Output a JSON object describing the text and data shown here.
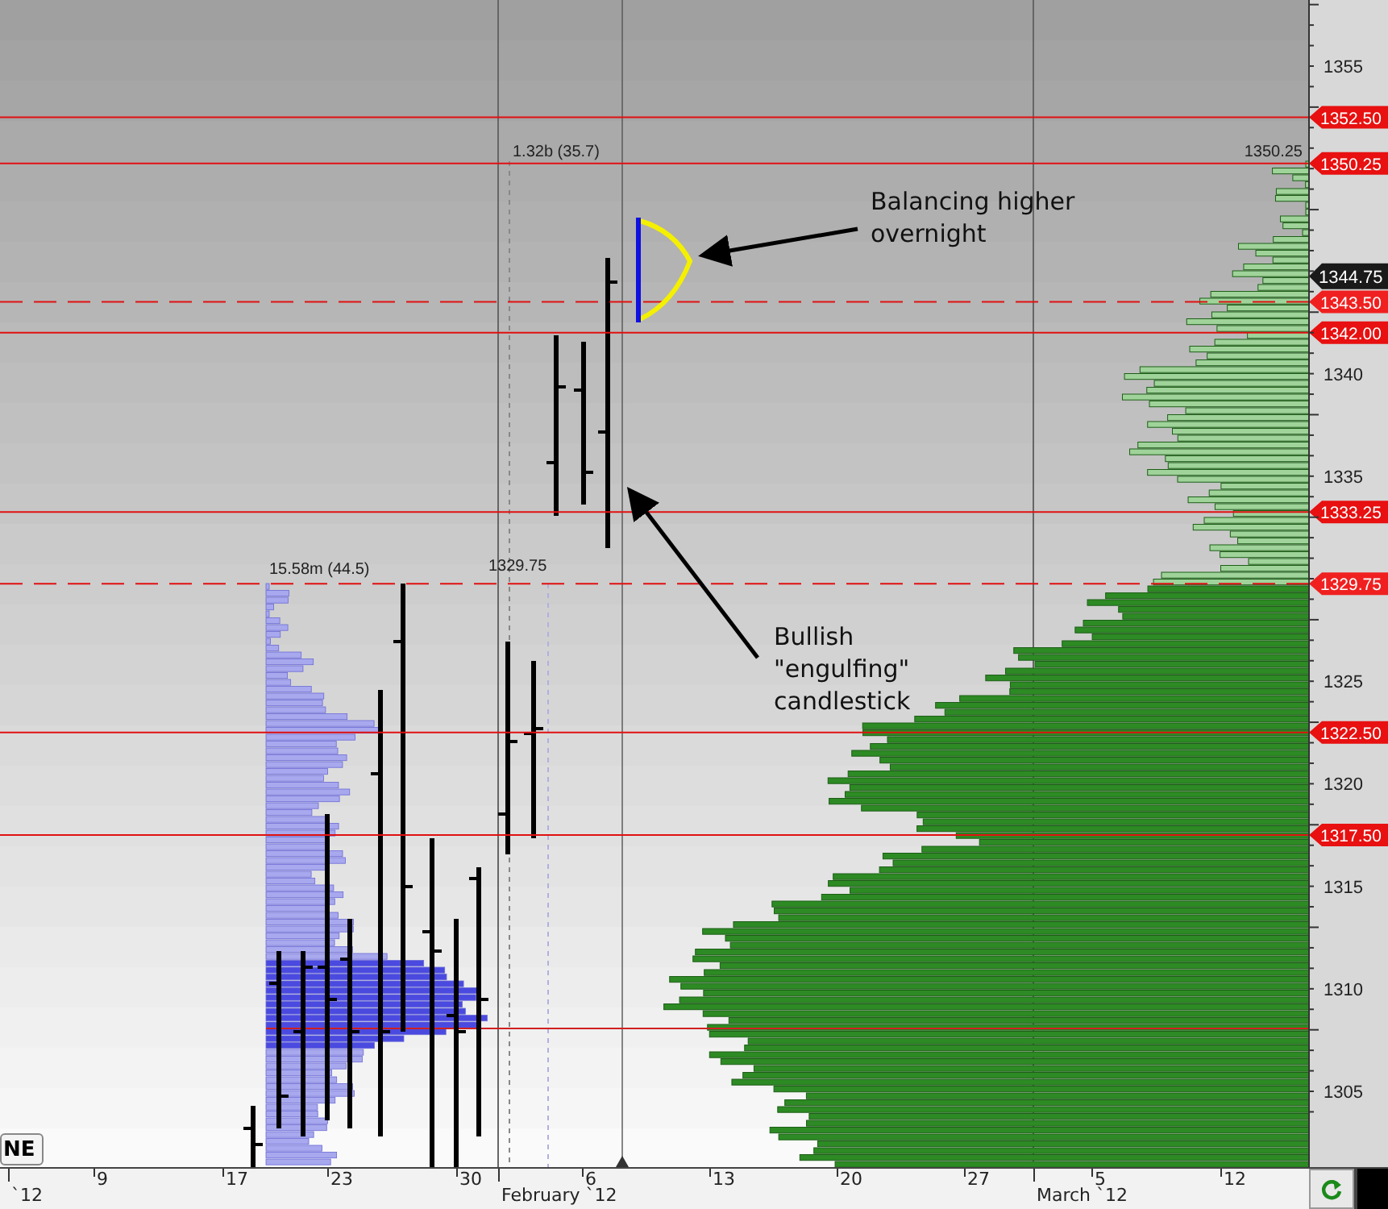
{
  "price_axis": {
    "labels": [
      "1355",
      "1340",
      "1335",
      "1325",
      "1320",
      "1315",
      "1310",
      "1305"
    ]
  },
  "price_levels": [
    {
      "price": "1352.50",
      "kind": "solid"
    },
    {
      "price": "1350.25",
      "kind": "solid"
    },
    {
      "price": "1343.50",
      "kind": "dashed"
    },
    {
      "price": "1342.00",
      "kind": "solid"
    },
    {
      "price": "1333.25",
      "kind": "solid"
    },
    {
      "price": "1329.75",
      "kind": "dashed"
    },
    {
      "price": "1322.50",
      "kind": "solid"
    },
    {
      "price": "1317.50",
      "kind": "solid"
    }
  ],
  "last_price": "1344.75",
  "profile_labels": [
    {
      "text": "1.32b (35.7)"
    },
    {
      "text": "1350.25"
    },
    {
      "text": "15.58m (44.5)"
    },
    {
      "text": "1329.75"
    }
  ],
  "annotations": [
    {
      "text": "Balancing higher overnight"
    },
    {
      "text": "Bullish \"engulfing\" candlestick"
    }
  ],
  "date_axis": {
    "labels": [
      {
        "text": "`12",
        "kind": "month"
      },
      {
        "text": "9",
        "kind": "day"
      },
      {
        "text": "17",
        "kind": "day"
      },
      {
        "text": "23",
        "kind": "day"
      },
      {
        "text": "30",
        "kind": "day"
      },
      {
        "text": "February `12",
        "kind": "month"
      },
      {
        "text": "6",
        "kind": "day"
      },
      {
        "text": "13",
        "kind": "day"
      },
      {
        "text": "20",
        "kind": "day"
      },
      {
        "text": "27",
        "kind": "day"
      },
      {
        "text": "March `12",
        "kind": "month"
      },
      {
        "text": "5",
        "kind": "day"
      },
      {
        "text": "12",
        "kind": "day"
      }
    ]
  },
  "buttons": {
    "left": "NE"
  }
}
